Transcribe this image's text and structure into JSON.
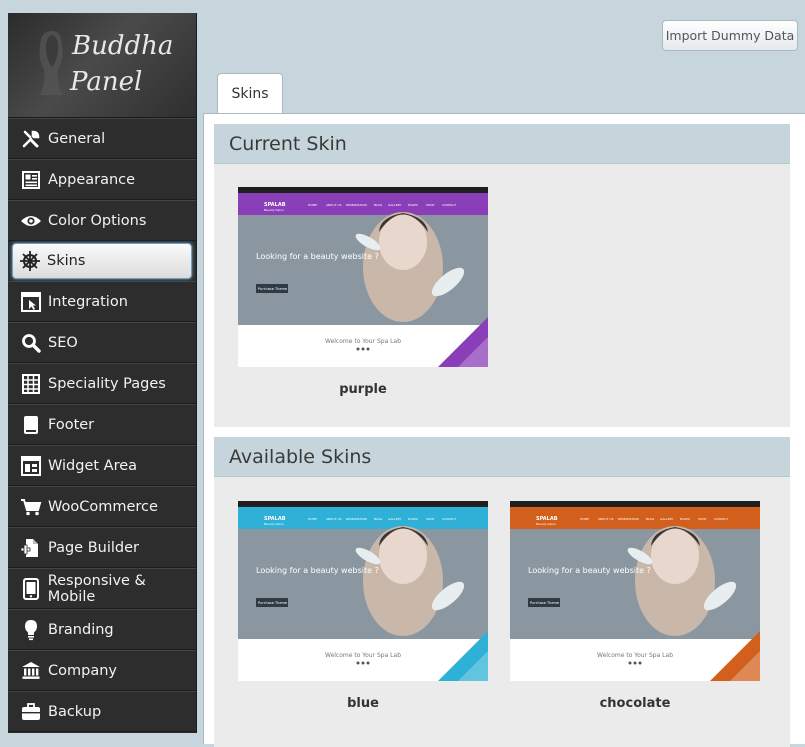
{
  "logo": {
    "line1": "Buddha",
    "line2": "Panel"
  },
  "nav": [
    {
      "label": "General",
      "icon": "wrench-icon"
    },
    {
      "label": "Appearance",
      "icon": "layout-icon"
    },
    {
      "label": "Color Options",
      "icon": "eye-icon"
    },
    {
      "label": "Skins",
      "icon": "helm-icon",
      "active": true
    },
    {
      "label": "Integration",
      "icon": "window-cursor-icon"
    },
    {
      "label": "SEO",
      "icon": "search-icon"
    },
    {
      "label": "Speciality Pages",
      "icon": "grid-icon"
    },
    {
      "label": "Footer",
      "icon": "footer-icon"
    },
    {
      "label": "Widget Area",
      "icon": "widget-icon"
    },
    {
      "label": "WooCommerce",
      "icon": "cart-icon"
    },
    {
      "label": "Page Builder",
      "icon": "page-plus-icon"
    },
    {
      "label": "Responsive & Mobile",
      "icon": "mobile-icon"
    },
    {
      "label": "Branding",
      "icon": "bulb-icon"
    },
    {
      "label": "Company",
      "icon": "bank-icon"
    },
    {
      "label": "Backup",
      "icon": "briefcase-icon"
    }
  ],
  "toolbar": {
    "import_label": "Import Dummy Data"
  },
  "tabs": [
    {
      "label": "Skins"
    }
  ],
  "current": {
    "title": "Current Skin",
    "skins": [
      {
        "name": "purple",
        "color": "#8a3fb8"
      }
    ]
  },
  "available": {
    "title": "Available Skins",
    "skins": [
      {
        "name": "blue",
        "color": "#2fb0d6"
      },
      {
        "name": "chocolate",
        "color": "#d2601c"
      }
    ]
  },
  "thumbnail": {
    "brand": "SPALAB",
    "tagline": "Beauty Salon",
    "hero": "Looking for a beauty website ?",
    "button": "Purchase Theme",
    "welcome": "Welcome to Your Spa Lab",
    "menu": [
      "HOME",
      "ABOUT US",
      "RESERVATION",
      "BLOG",
      "GALLERY",
      "PAGES",
      "SHOP",
      "CONTACT"
    ]
  }
}
